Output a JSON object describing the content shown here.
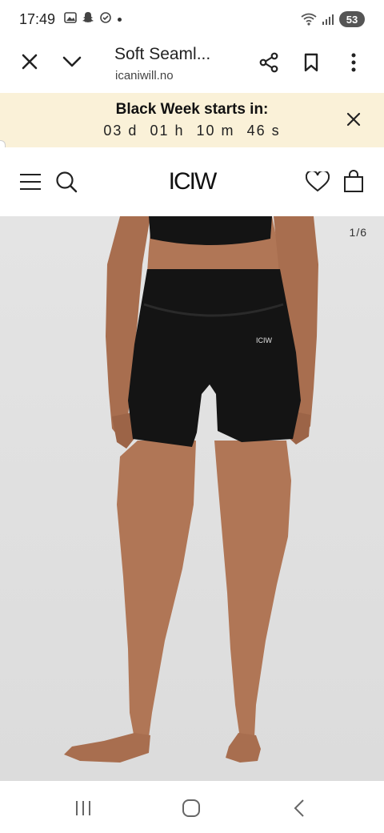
{
  "status_bar": {
    "time": "17:49",
    "battery": "53"
  },
  "browser": {
    "title": "Soft Seaml...",
    "url": "icaniwill.no"
  },
  "banner": {
    "title": "Black Week starts in:",
    "countdown": [
      "03 d",
      "01 h",
      "10 m",
      "46 s"
    ]
  },
  "shop": {
    "logo": "ICIW"
  },
  "product_image": {
    "counter": "1/6",
    "print_logo": "ICIW"
  },
  "colors": {
    "banner_bg": "#faf1d8",
    "image_bg": "#e0e0e0",
    "garment": "#141414",
    "skin": "#b07656"
  }
}
